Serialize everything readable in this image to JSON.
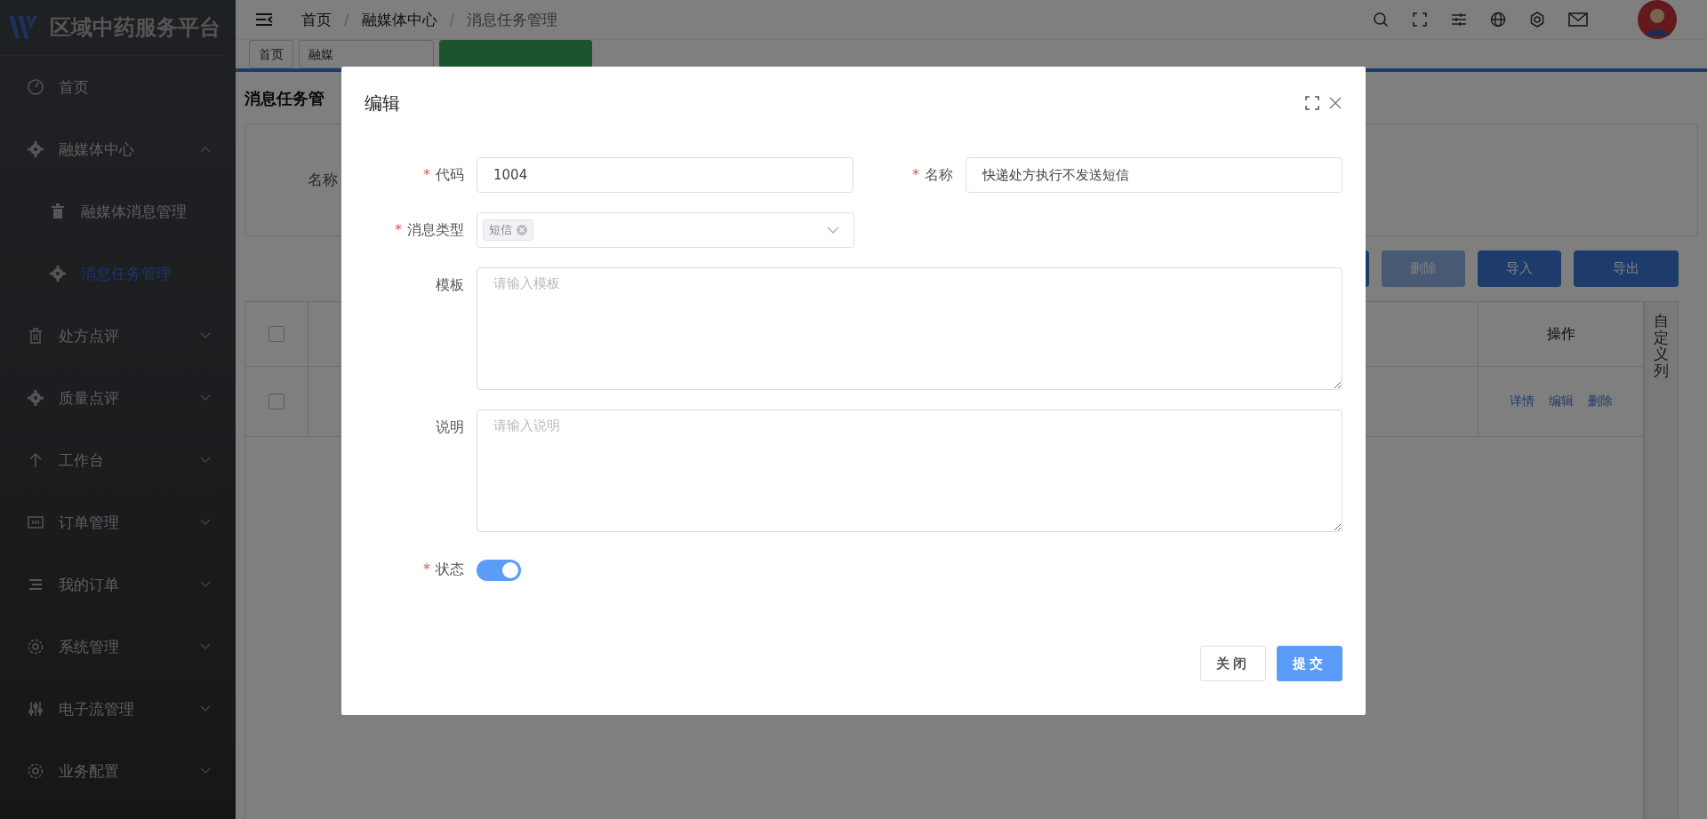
{
  "sidebar": {
    "logo_text": "区域中药服务平台",
    "items": [
      {
        "label": "首页"
      },
      {
        "label": "融媒体中心",
        "expanded": true,
        "children": [
          {
            "label": "融媒体消息管理",
            "selected": false
          },
          {
            "label": "消息任务管理",
            "selected": true
          }
        ]
      },
      {
        "label": "处方点评",
        "expanded": false
      },
      {
        "label": "质量点评",
        "expanded": false
      },
      {
        "label": "工作台",
        "expanded": false
      },
      {
        "label": "订单管理",
        "expanded": false
      },
      {
        "label": "我的订单",
        "expanded": false
      },
      {
        "label": "系统管理",
        "expanded": false
      },
      {
        "label": "电子流管理",
        "expanded": false
      },
      {
        "label": "业务配置",
        "expanded": false
      }
    ]
  },
  "header": {
    "breadcrumb": [
      "首页",
      "融媒体中心",
      "消息任务管理"
    ],
    "separator": "/"
  },
  "tabs": [
    {
      "label": "首页",
      "selected": false
    },
    {
      "label": "融媒",
      "selected": false
    },
    {
      "selected": true
    }
  ],
  "page": {
    "title": "消息任务管",
    "search_label": "名称",
    "toolbar": [
      {
        "label": "删除",
        "disabled": true
      },
      {
        "label": "导入",
        "disabled": false
      },
      {
        "label": "导出",
        "disabled": false
      }
    ],
    "table": {
      "header_checked": false,
      "row_checked": false,
      "column_header": "操作",
      "row_actions": [
        "详情",
        "编辑",
        "删除"
      ],
      "customize": "自定义列"
    }
  },
  "dialog": {
    "title": "编辑",
    "required_mark": "*",
    "fields": [
      {
        "kind": "input",
        "label": "代码",
        "required": true,
        "value": "1004"
      },
      {
        "kind": "input",
        "label": "名称",
        "required": true,
        "value": "快递处方执行不发送短信"
      },
      {
        "kind": "select",
        "label": "消息类型",
        "required": true,
        "tags": [
          "短信"
        ]
      },
      {
        "kind": "textarea",
        "label": "模板",
        "required": false,
        "placeholder": "请输入模板"
      },
      {
        "kind": "textarea",
        "label": "说明",
        "required": false,
        "placeholder": "请输入说明"
      },
      {
        "kind": "switch",
        "label": "状态",
        "required": true,
        "on": true
      }
    ],
    "buttons": [
      {
        "label": "关闭",
        "primary": false
      },
      {
        "label": "提交",
        "primary": true
      }
    ]
  }
}
